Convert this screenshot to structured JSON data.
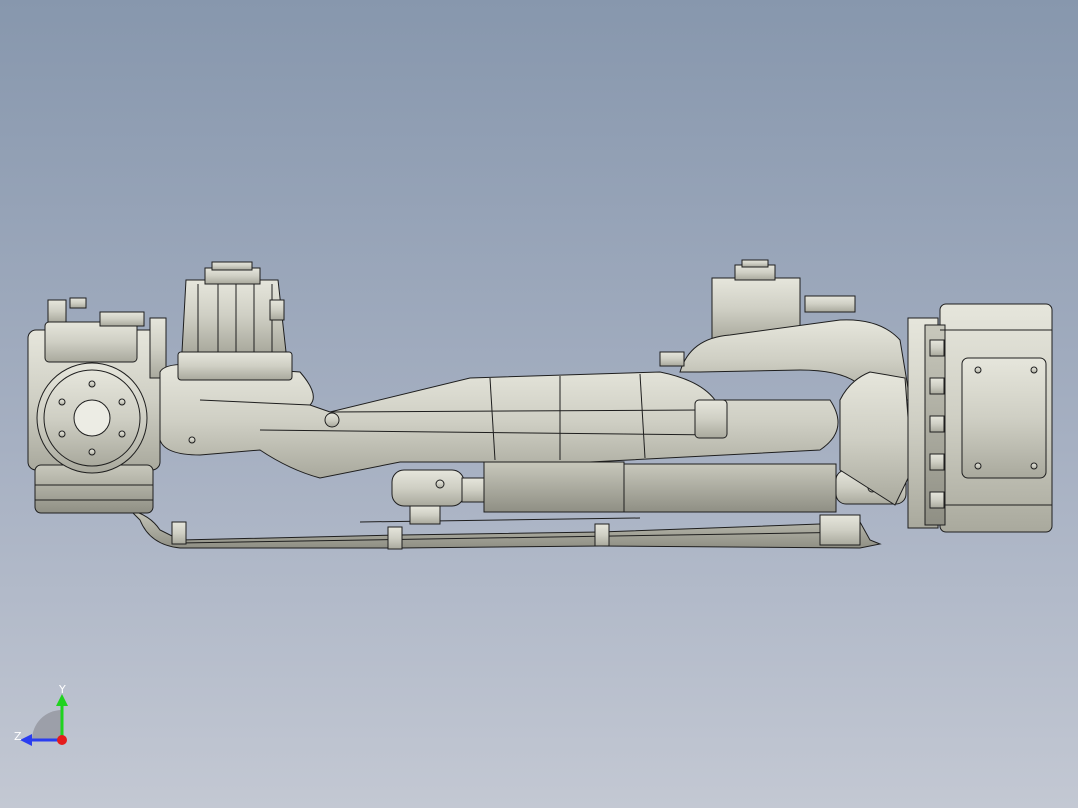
{
  "viewport": {
    "background_top": "#8797ad",
    "background_bottom": "#c3c8d3",
    "part_fill": "#d3d3c8",
    "part_shade": "#b4b4a8",
    "edge_color": "#1e1e1e"
  },
  "triad": {
    "y_label": "Y",
    "z_label": "Z",
    "y_color": "#1fd31f",
    "z_color": "#2a3df0",
    "x_color": "#e51b1b"
  }
}
